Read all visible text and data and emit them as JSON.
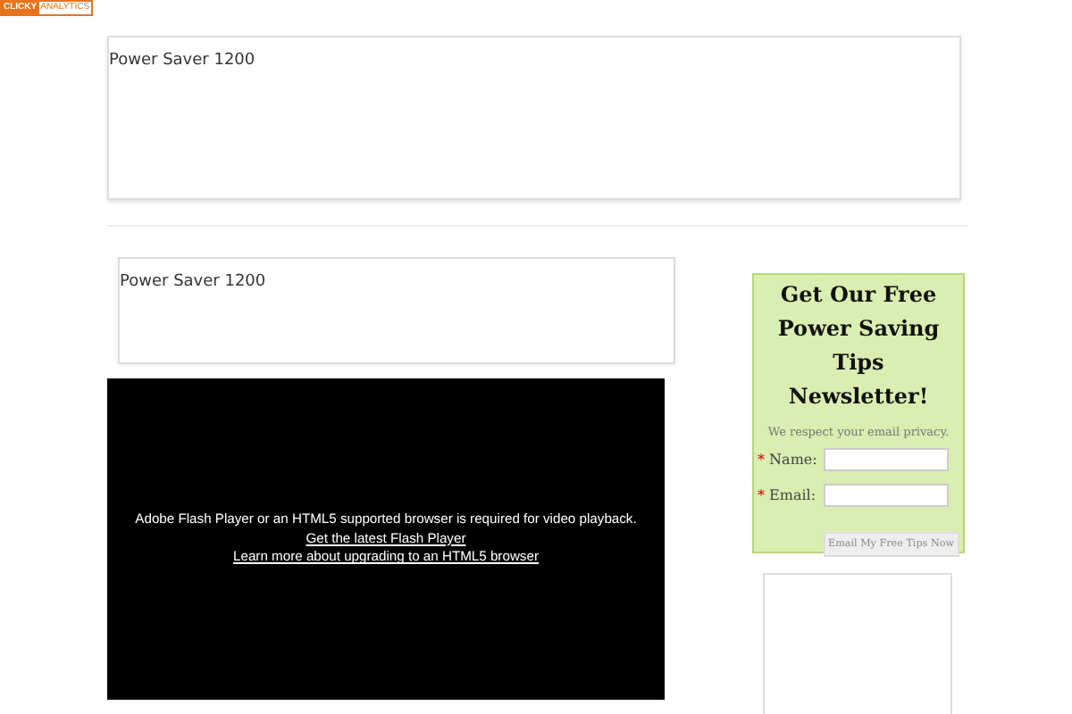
{
  "badge": {
    "parts": [
      "CLICKY",
      "ANALYTICS"
    ]
  },
  "top_box": {
    "text": "Power Saver 1200"
  },
  "product_box": {
    "text": "Power Saver 1200"
  },
  "video": {
    "message": "Adobe Flash Player or an HTML5 supported browser is required for video playback.",
    "links": [
      "Get the latest Flash Player",
      "Learn more about upgrading to an HTML5 browser"
    ]
  },
  "newsletter": {
    "title_lines": [
      "Get Our Free",
      "Power Saving Tips",
      "Newsletter!"
    ],
    "privacy": "We respect your email privacy.",
    "fields": [
      {
        "required_mark": "*",
        "label": "Name:"
      },
      {
        "required_mark": "*",
        "label": "Email:"
      }
    ],
    "button": "Email My Free Tips Now"
  }
}
